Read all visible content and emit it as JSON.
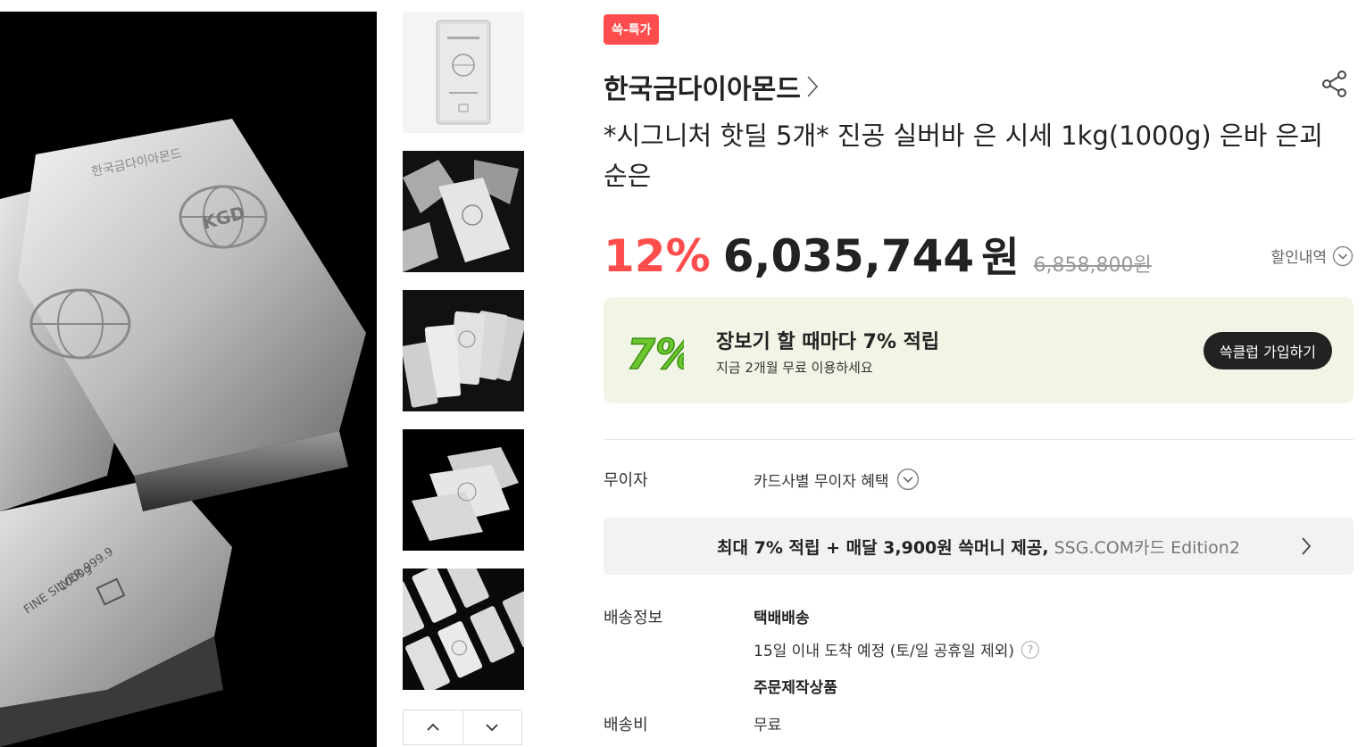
{
  "badge": "쓱-특가",
  "brand": "한국금다이아몬드",
  "title": "*시그니처 핫딜 5개* 진공 실버바 은 시세 1kg(1000g) 은바 은괴 순은",
  "price": {
    "discount_rate": "12%",
    "sale_price": "6,035,744",
    "currency": "원",
    "original_price": "6,858,800원",
    "discount_detail_label": "할인내역"
  },
  "promo": {
    "icon_text": "7%",
    "title": "장보기 할 때마다 7% 적립",
    "subtitle": "지금 2개월 무료 이용하세요",
    "button": "쓱클럽 가입하기"
  },
  "installment": {
    "label": "무이자",
    "value": "카드사별 무이자 혜택"
  },
  "card_banner": {
    "text": "최대 7% 적립 + 매달 3,900원 쓱머니 제공,",
    "card_name": "SSG.COM카드 Edition2"
  },
  "shipping": {
    "label": "배송정보",
    "method": "택배배송",
    "eta": "15일 이내 도착 예정 (토/일 공휴일 제외)",
    "note": "주문제작상품"
  },
  "shipping_fee": {
    "label": "배송비",
    "value": "무료"
  },
  "icons": {
    "share": "share-icon",
    "brand_arrow": "chevron-right-icon",
    "discount_toggle": "chevron-down-circle-icon",
    "help": "question-circle-icon",
    "thumb_up": "chevron-up-icon",
    "thumb_down": "chevron-down-icon"
  },
  "main_image_engraving": {
    "brand_text": "한국금다이아몬드",
    "logo": "KGD",
    "fine_silver": "FINE SILVER 999.9",
    "weight": "1000g"
  },
  "colors": {
    "accent": "#ff4d4d",
    "promo_bg": "#f1f5e6",
    "promo_icon": "#6bc72d",
    "dark_button": "#222222"
  }
}
